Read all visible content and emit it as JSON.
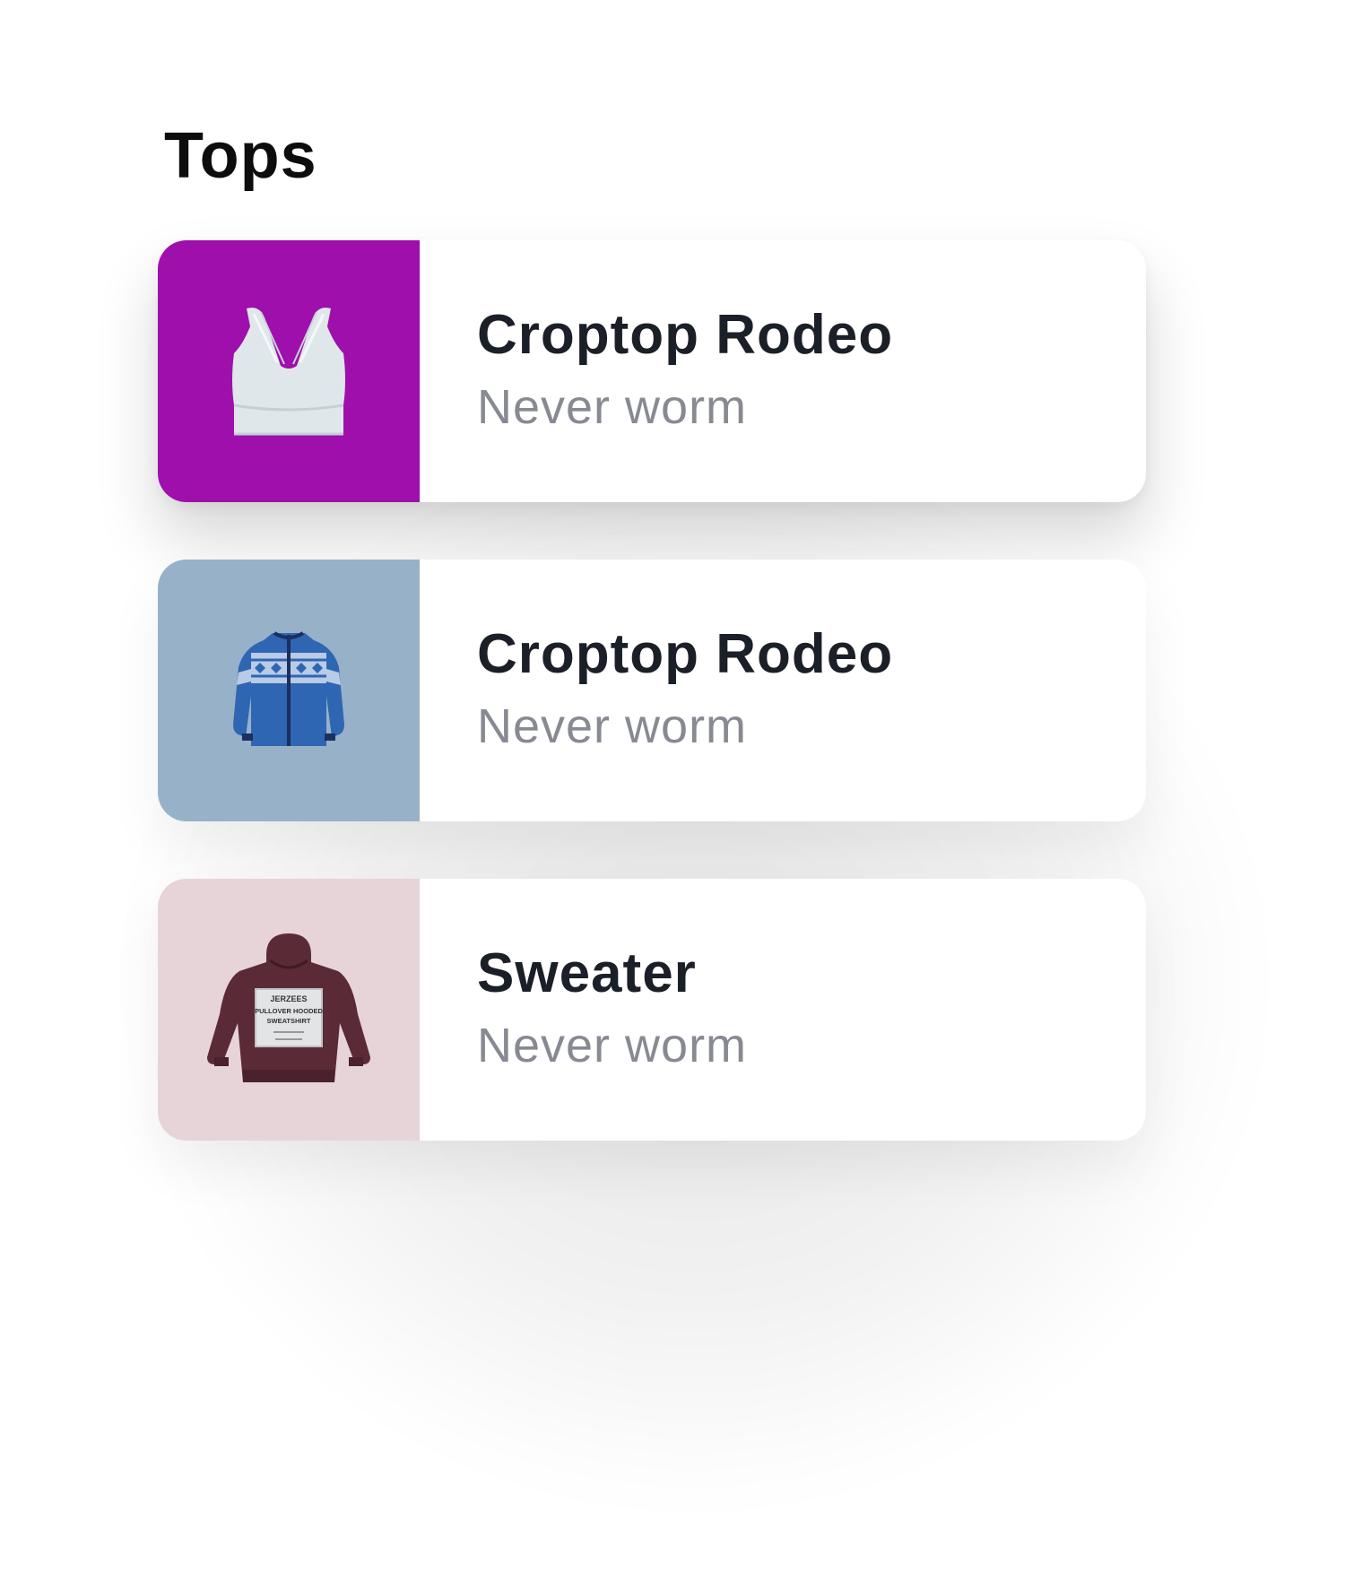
{
  "section": {
    "title": "Tops"
  },
  "items": [
    {
      "title": "Croptop Rodeo",
      "subtitle": "Never worm",
      "thumb_color": "#9e0fac",
      "icon": "sports-bra-icon"
    },
    {
      "title": "Croptop Rodeo",
      "subtitle": "Never worm",
      "thumb_color": "#97b1c9",
      "icon": "fleece-jacket-icon"
    },
    {
      "title": "Sweater",
      "subtitle": "Never worm",
      "thumb_color": "#e6d4d9",
      "icon": "hoodie-icon",
      "print_text": "JERZEES PULLOVER HOODED SWEATSHIRT"
    }
  ]
}
